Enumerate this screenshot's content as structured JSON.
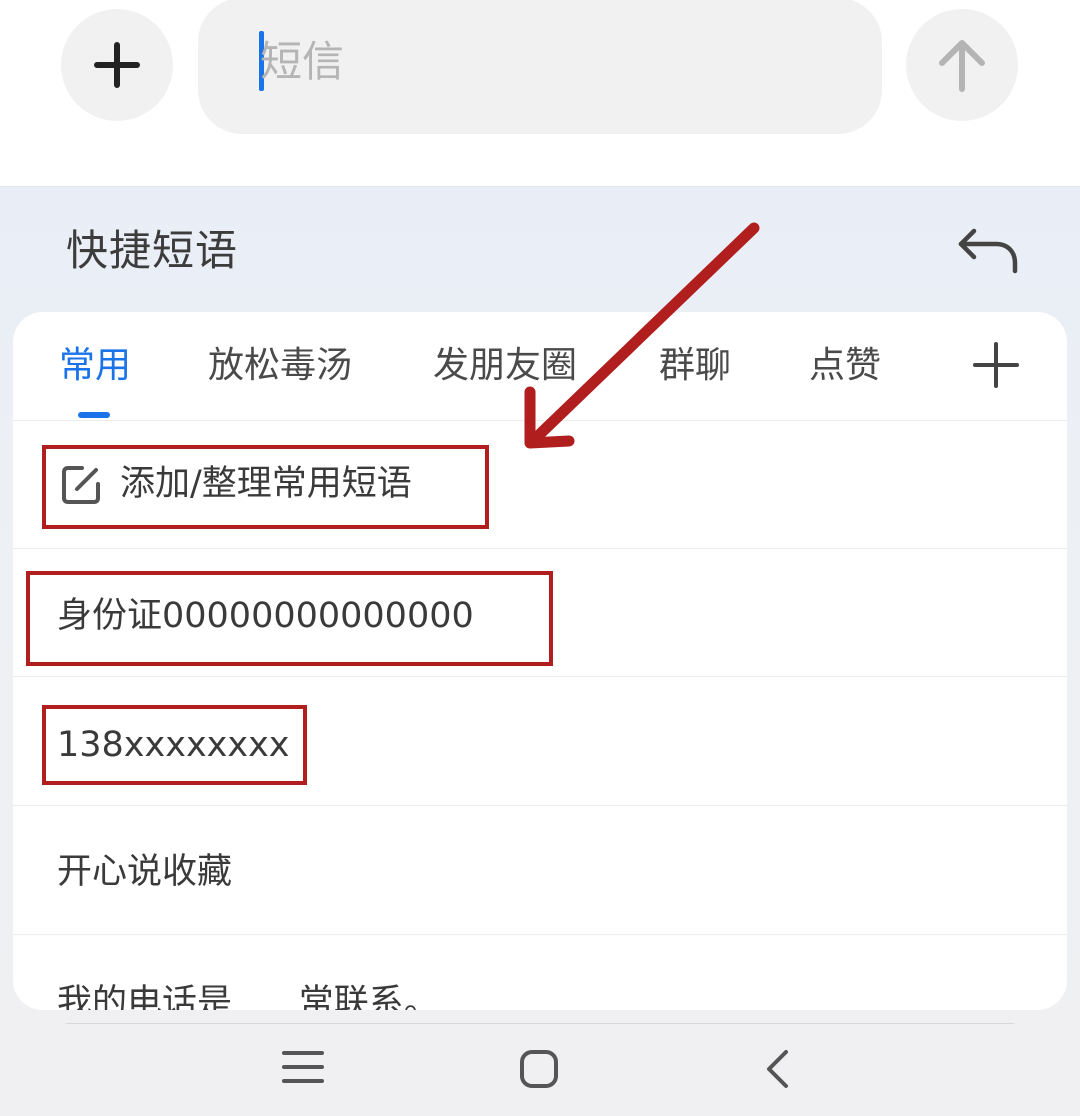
{
  "compose": {
    "attach_icon": "plus-icon",
    "input_placeholder": "短信",
    "send_icon": "arrow-up-icon"
  },
  "quick_phrases": {
    "title": "快捷短语",
    "back_icon": "undo-icon",
    "tabs": [
      {
        "label": "常用",
        "active": true
      },
      {
        "label": "放松毒汤",
        "active": false
      },
      {
        "label": "发朋友圈",
        "active": false
      },
      {
        "label": "群聊",
        "active": false
      },
      {
        "label": "点赞",
        "active": false
      }
    ],
    "add_tab_icon": "plus-icon",
    "manage_label": "添加/整理常用短语",
    "phrases": [
      "身份证00000000000000",
      "138xxxxxxxx",
      "开心说收藏",
      "我的电话是      常联系。"
    ]
  },
  "nav_bar": {
    "menu_icon": "menu-icon",
    "home_icon": "home-icon",
    "back_icon": "back-icon"
  },
  "colors": {
    "accent": "#1a73e8",
    "annotation": "#b01e1e",
    "panel_bg": "#eceff4"
  }
}
